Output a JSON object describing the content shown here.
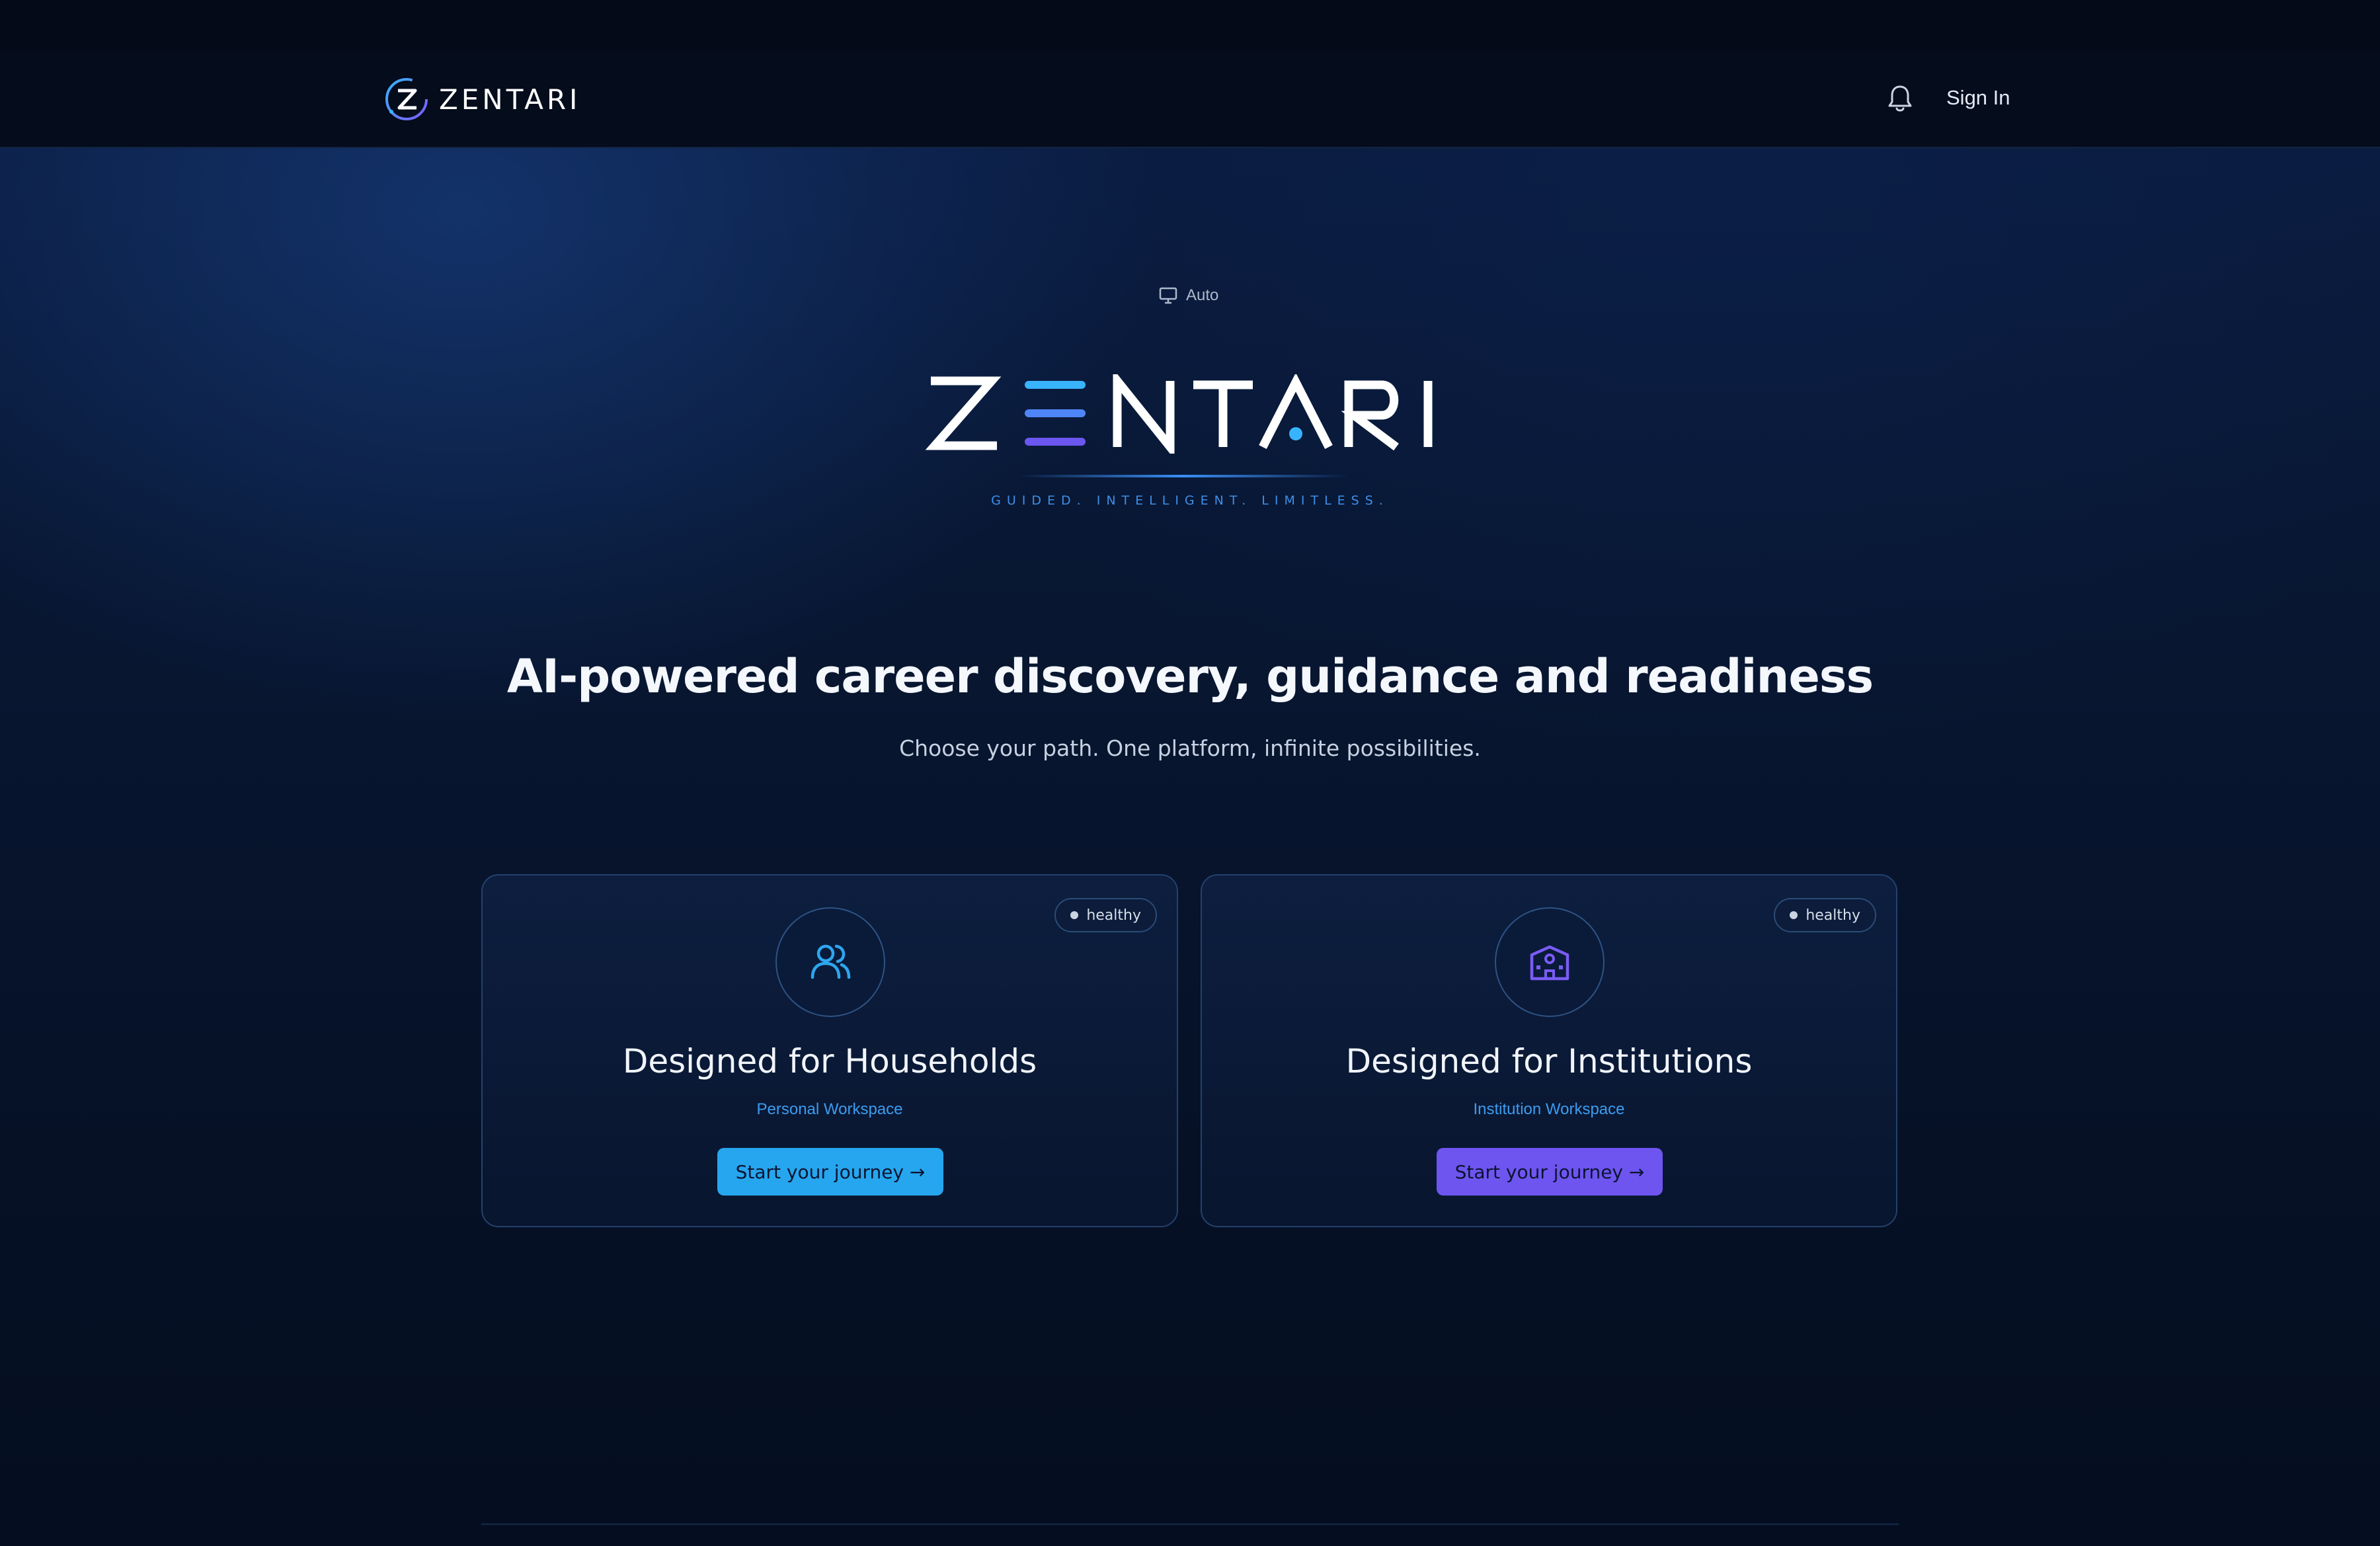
{
  "brand": {
    "name": "ZENTARI",
    "tagline": "GUIDED. INTELLIGENT. LIMITLESS."
  },
  "nav": {
    "sign_in": "Sign In",
    "icons": [
      "logo-mark-icon",
      "bell-icon"
    ]
  },
  "theme_toggle": {
    "label": "Auto",
    "icon": "monitor-icon"
  },
  "hero": {
    "headline": "AI-powered career discovery, guidance and readiness",
    "subheadline": "Choose your path. One platform, infinite possibilities."
  },
  "cards": [
    {
      "title": "Designed for Households",
      "subtitle": "Personal Workspace",
      "status": "healthy",
      "button": "Start your journey →",
      "icon": "users-icon",
      "accent": "#26a6ee"
    },
    {
      "title": "Designed for Institutions",
      "subtitle": "Institution Workspace",
      "status": "healthy",
      "button": "Start your journey →",
      "icon": "school-building-icon",
      "accent": "#6e55f0"
    }
  ],
  "colors": {
    "background": "#061024",
    "accent_blue": "#26a6ee",
    "accent_purple": "#6e55f0",
    "link_blue": "#3b9cf0"
  }
}
